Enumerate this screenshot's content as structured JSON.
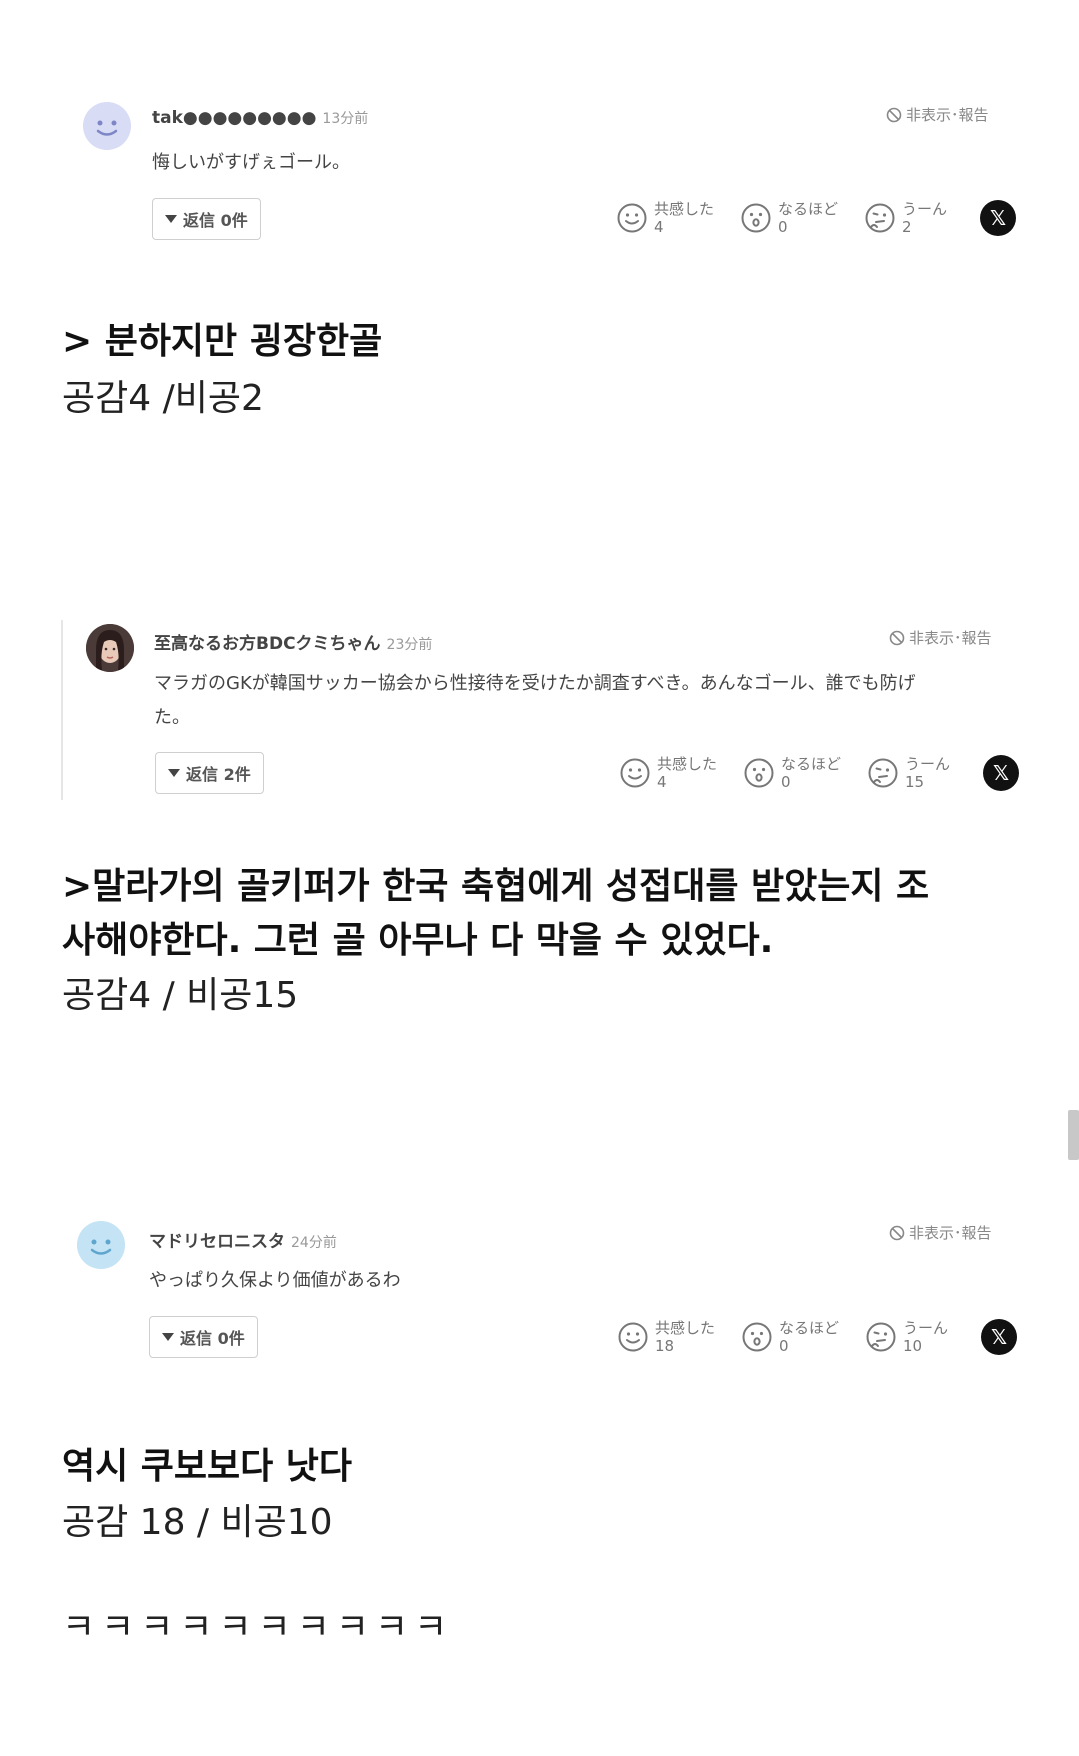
{
  "comments": [
    {
      "username": "tak●●●●●●●●●",
      "timestamp": "13分前",
      "report_label": "非表示･報告",
      "text_lines": [
        "悔しいがすげぇゴール。"
      ],
      "reply_label": "返信 0件",
      "reactions": [
        {
          "label": "共感した",
          "count": "4",
          "icon": "smile-face-icon"
        },
        {
          "label": "なるほど",
          "count": "0",
          "icon": "surprised-face-icon"
        },
        {
          "label": "うーん",
          "count": "2",
          "icon": "thinking-face-icon"
        }
      ],
      "share_icon": "x-logo-icon",
      "translation": "> 분하지만 굉장한골",
      "votes": "공감4 /비공2"
    },
    {
      "username": "至高なるお方BDCクミちゃん",
      "timestamp": "23分前",
      "report_label": "非表示･報告",
      "text_lines": [
        "マラガのGKが韓国サッカー協会から性接待を受けたか調査すべき。あんなゴール、誰でも防げ",
        "た。"
      ],
      "reply_label": "返信 2件",
      "reactions": [
        {
          "label": "共感した",
          "count": "4",
          "icon": "smile-face-icon"
        },
        {
          "label": "なるほど",
          "count": "0",
          "icon": "surprised-face-icon"
        },
        {
          "label": "うーん",
          "count": "15",
          "icon": "thinking-face-icon"
        }
      ],
      "share_icon": "x-logo-icon",
      "translation_lines": [
        ">말라가의 골키퍼가 한국 축협에게 성접대를 받았는지 조",
        "사해야한다. 그런 골 아무나 다 막을 수 있었다."
      ],
      "votes": "공감4 / 비공15"
    },
    {
      "username": "マドリセロニスタ",
      "timestamp": "24分前",
      "report_label": "非表示･報告",
      "text_lines": [
        "やっぱり久保より価値があるわ"
      ],
      "reply_label": "返信 0件",
      "reactions": [
        {
          "label": "共感した",
          "count": "18",
          "icon": "smile-face-icon"
        },
        {
          "label": "なるほど",
          "count": "0",
          "icon": "surprised-face-icon"
        },
        {
          "label": "うーん",
          "count": "10",
          "icon": "thinking-face-icon"
        }
      ],
      "share_icon": "x-logo-icon",
      "translation": "역시 쿠보보다 낫다",
      "votes": "공감 18 / 비공10"
    }
  ],
  "final_text": "ㅋㅋㅋㅋㅋㅋㅋㅋㅋㅋ",
  "colors": {
    "avatar_lavender": "#d9dcf5",
    "avatar_lightblue": "#c4e3f5",
    "x_button": "#111111"
  }
}
